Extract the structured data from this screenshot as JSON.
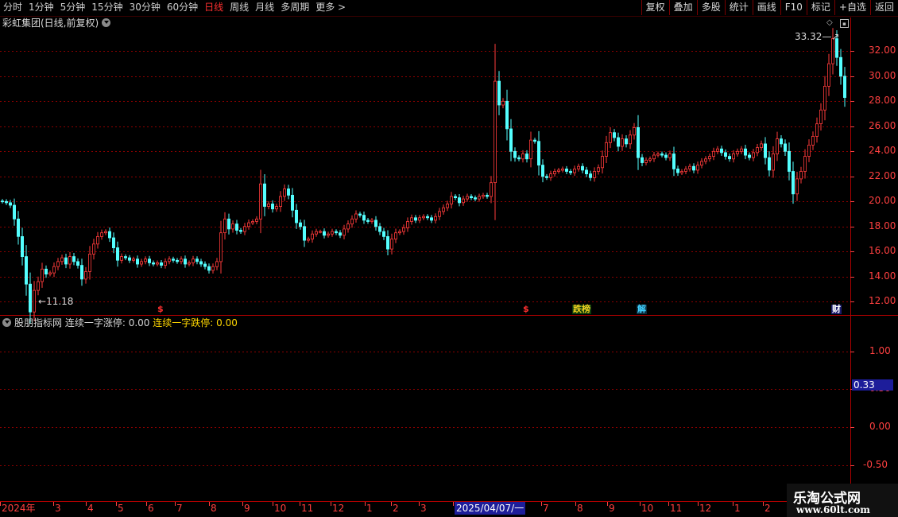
{
  "toolbar": {
    "periods": [
      {
        "label": "分时",
        "active": false
      },
      {
        "label": "1分钟",
        "active": false
      },
      {
        "label": "5分钟",
        "active": false
      },
      {
        "label": "15分钟",
        "active": false
      },
      {
        "label": "30分钟",
        "active": false
      },
      {
        "label": "60分钟",
        "active": false
      },
      {
        "label": "日线",
        "active": true
      },
      {
        "label": "周线",
        "active": false
      },
      {
        "label": "月线",
        "active": false
      },
      {
        "label": "多周期",
        "active": false
      },
      {
        "label": "更多 >",
        "active": false
      }
    ],
    "buttons": [
      "复权",
      "叠加",
      "多股",
      "统计",
      "画线",
      "F10",
      "标记",
      "+自选",
      "返回"
    ]
  },
  "main": {
    "title": "彩虹集团(日线,前复权)",
    "high_note": "33.32",
    "low_note": "11.18",
    "y_ticks": [
      "32.00",
      "30.00",
      "28.00",
      "26.00",
      "24.00",
      "22.00",
      "20.00",
      "18.00",
      "16.00",
      "14.00",
      "12.00"
    ],
    "markers": [
      {
        "text": "$",
        "kind": "s"
      },
      {
        "text": "$",
        "kind": "s"
      },
      {
        "text": "跌榜",
        "kind": "t"
      },
      {
        "text": "解",
        "kind": "j"
      },
      {
        "text": "财",
        "kind": "c"
      }
    ]
  },
  "indicator": {
    "name": "股朋指标网",
    "label1": "连续一字涨停:",
    "value1": "0.00",
    "label2": "连续一字跌停:",
    "value2": "0.00",
    "y_ticks": [
      "1.00",
      "0.50",
      "0.00",
      "-0.50"
    ],
    "cursor_value": "0.33"
  },
  "date_axis": {
    "labels": [
      "2024年",
      "3",
      "4",
      "5",
      "6",
      "7",
      "8",
      "9",
      "10",
      "11",
      "12",
      "1",
      "2",
      "3",
      "2025/04/07/一",
      "7",
      "8",
      "9",
      "10",
      "11",
      "12",
      "1",
      "2"
    ]
  },
  "watermark": {
    "title": "乐淘公式网",
    "url": "www.60lt.com"
  },
  "colors": {
    "up": "#ff3b3b",
    "down": "#54ffff",
    "grid": "#8b0000",
    "axis": "#ff4040",
    "highlight": "#1d1d9a"
  },
  "chart_data": {
    "type": "candlestick",
    "ylim": [
      11.0,
      33.8
    ],
    "series": [
      {
        "values": [
          20.0,
          19.9,
          19.7,
          18.6,
          17.2,
          15.6,
          13.4,
          11.18,
          12.9,
          13.6,
          14.6,
          14.2,
          14.3,
          14.8,
          15.2,
          15.5,
          15.0,
          15.6,
          15.2,
          14.9,
          13.8,
          14.4,
          15.8,
          16.6,
          17.2,
          17.5,
          17.6,
          17.1,
          16.3,
          15.3,
          15.6,
          15.5,
          15.3,
          15.4,
          15.0,
          15.2,
          15.4,
          15.1,
          15.0,
          15.1,
          14.9,
          15.2,
          15.4,
          15.3,
          15.2,
          15.4,
          15.0,
          15.1,
          15.4,
          15.2,
          15.0,
          14.8,
          14.5,
          14.8,
          15.2,
          17.5,
          18.6,
          17.8,
          18.2,
          17.7,
          17.6,
          18.0,
          18.3,
          18.4,
          18.6,
          21.4,
          19.6,
          19.8,
          19.4,
          19.6,
          20.4,
          21.0,
          20.5,
          19.3,
          18.3,
          18.0,
          16.9,
          17.0,
          17.4,
          17.6,
          17.6,
          17.3,
          17.4,
          17.6,
          17.5,
          17.3,
          17.8,
          18.2,
          18.6,
          19.0,
          18.9,
          18.5,
          18.4,
          18.5,
          18.0,
          17.6,
          17.2,
          16.2,
          17.0,
          17.5,
          17.6,
          17.9,
          18.4,
          18.7,
          18.5,
          18.7,
          18.8,
          18.7,
          18.5,
          18.8,
          19.2,
          19.5,
          19.8,
          20.4,
          20.3,
          19.9,
          20.2,
          20.4,
          20.3,
          20.2,
          20.4,
          20.5,
          20.4,
          21.5,
          29.6,
          27.7,
          28.0,
          25.8,
          24.0,
          23.5,
          23.4,
          23.8,
          23.4,
          24.9,
          24.8,
          22.9,
          22.0,
          21.9,
          22.2,
          22.4,
          22.5,
          22.6,
          22.4,
          22.3,
          22.6,
          22.8,
          22.5,
          22.2,
          21.9,
          22.4,
          22.7,
          23.6,
          24.7,
          25.5,
          25.1,
          24.4,
          25.0,
          24.6,
          25.3,
          25.9,
          23.5,
          23.1,
          23.3,
          23.4,
          23.7,
          23.8,
          23.7,
          23.5,
          23.8,
          22.6,
          22.3,
          22.4,
          22.6,
          22.8,
          22.5,
          22.9,
          23.2,
          23.4,
          23.6,
          24.0,
          24.2,
          23.9,
          23.6,
          23.4,
          23.8,
          24.0,
          24.2,
          23.7,
          23.5,
          23.9,
          24.3,
          24.6,
          23.5,
          22.5,
          23.8,
          25.0,
          24.6,
          24.0,
          22.4,
          20.6,
          21.8,
          22.4,
          23.6,
          24.5,
          25.2,
          26.2,
          27.3,
          29.2,
          31.0,
          33.0,
          31.5,
          30.0,
          28.3
        ]
      }
    ]
  }
}
